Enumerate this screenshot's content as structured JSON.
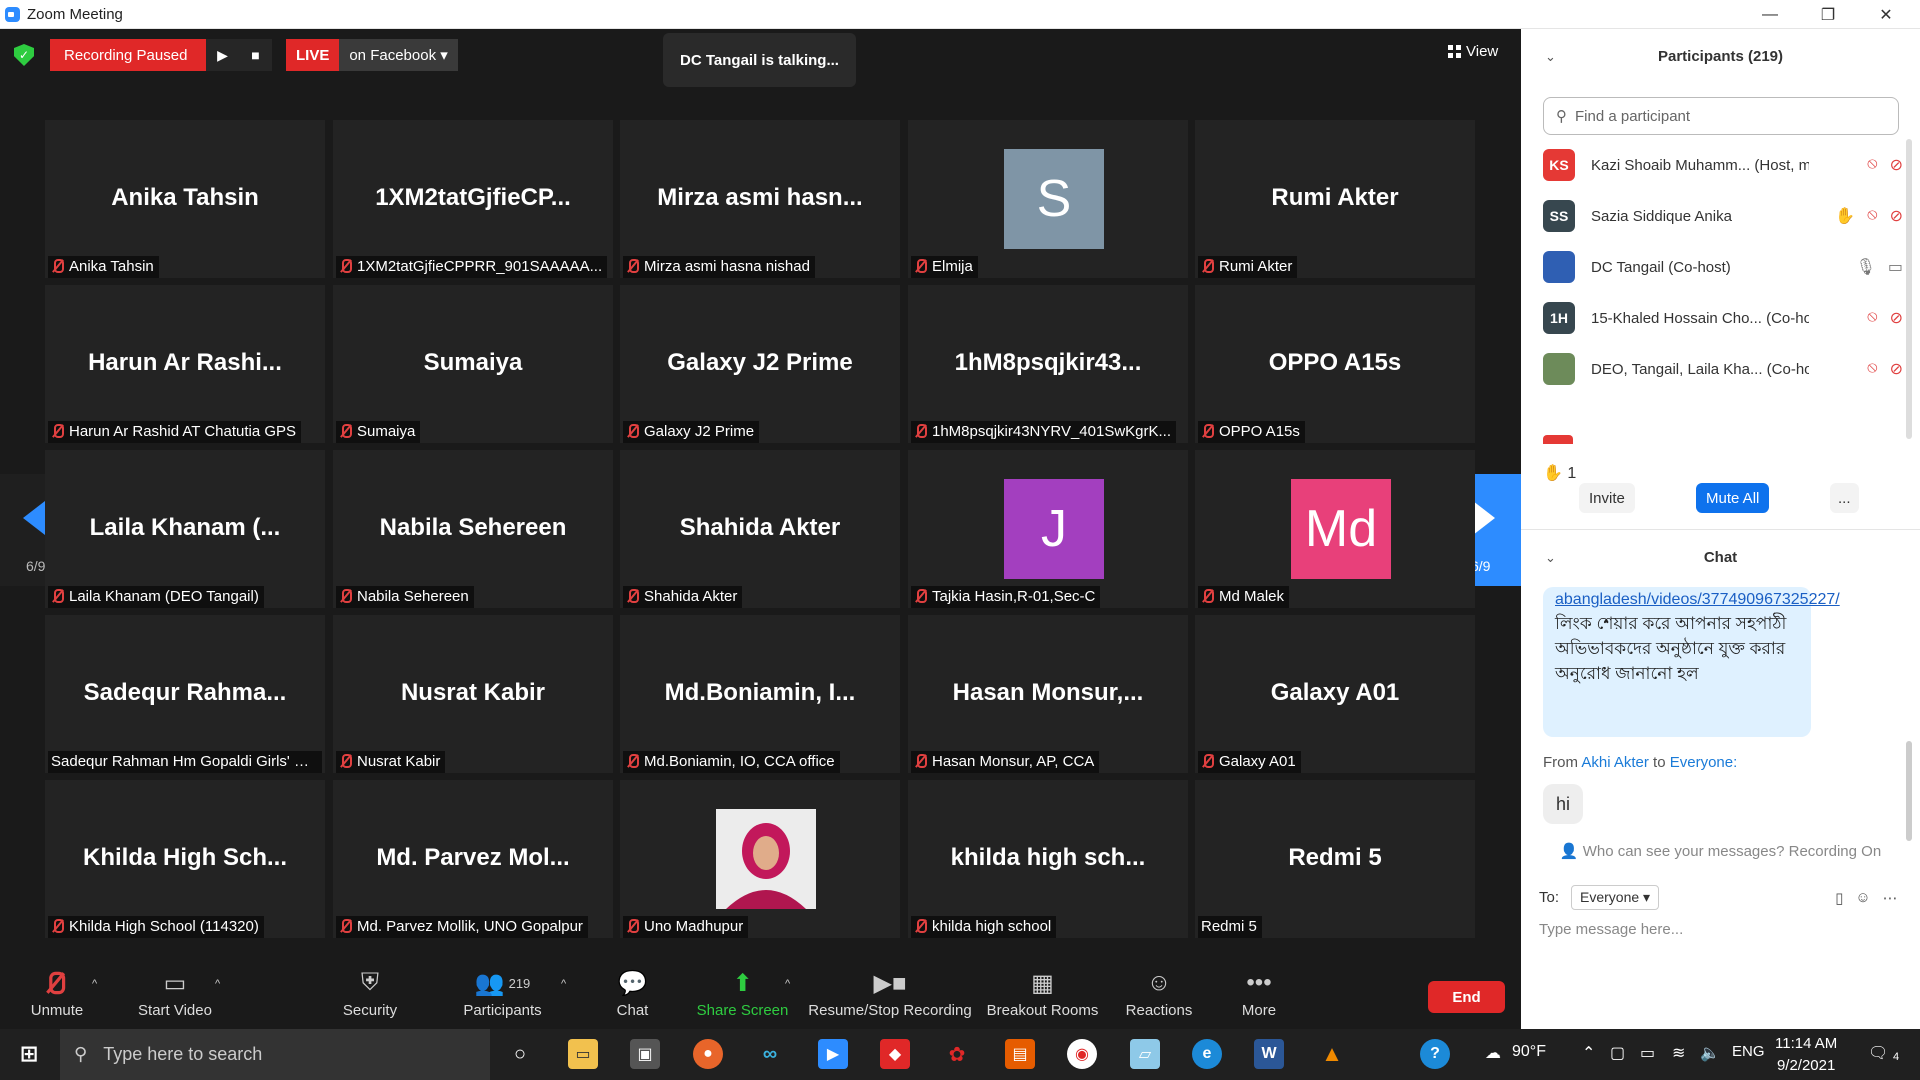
{
  "window": {
    "title": "Zoom Meeting",
    "minimize": "—",
    "restore": "❐",
    "close": "✕"
  },
  "top": {
    "recording_label": "Recording Paused",
    "play": "▶",
    "stop": "■",
    "live": "LIVE",
    "live_target": "on Facebook ▾",
    "talking": "DC Tangail is talking...",
    "view": "View"
  },
  "page_indicator": "6/9",
  "tiles": [
    {
      "big": "Anika Tahsin",
      "label": "Anika Tahsin",
      "muted": true
    },
    {
      "big": "1XM2tatGjfieCP...",
      "label": "1XM2tatGjfieCPPRR_901SAAAAA...",
      "muted": true
    },
    {
      "big": "Mirza  asmi  hasn...",
      "label": "Mirza asmi hasna nishad",
      "muted": true
    },
    {
      "avatar": "S",
      "avatar_color": "#7f95a6",
      "label": "Elmija",
      "muted": true
    },
    {
      "big": "Rumi Akter",
      "label": "Rumi Akter",
      "muted": true
    },
    {
      "big": "Harun  Ar  Rashi...",
      "label": "Harun Ar Rashid AT Chatutia GPS",
      "muted": true
    },
    {
      "big": "Sumaiya",
      "label": "Sumaiya",
      "muted": true
    },
    {
      "big": "Galaxy J2 Prime",
      "label": "Galaxy J2 Prime",
      "muted": true
    },
    {
      "big": "1hM8psqjkir43...",
      "label": "1hM8psqjkir43NYRV_401SwKgrK...",
      "muted": true
    },
    {
      "big": "OPPO A15s",
      "label": "OPPO A15s",
      "muted": true
    },
    {
      "big": "Laila  Khanam  (...",
      "label": "Laila Khanam (DEO Tangail)",
      "muted": true
    },
    {
      "big": "Nabila Sehereen",
      "label": "Nabila Sehereen",
      "muted": true
    },
    {
      "big": "Shahida Akter",
      "label": "Shahida Akter",
      "muted": true
    },
    {
      "avatar": "J",
      "avatar_color": "#a33fbf",
      "label": "Tajkia Hasin,R-01,Sec-C",
      "muted": true
    },
    {
      "avatar": "Md",
      "avatar_color": "#e8407a",
      "label": "Md Malek",
      "muted": true
    },
    {
      "big": "Sadequr  Rahma...",
      "label": "Sadequr Rahman Hm Gopaldi Girls' H...",
      "muted": false
    },
    {
      "big": "Nusrat Kabir",
      "label": "Nusrat Kabir",
      "muted": true
    },
    {
      "big": "Md.Boniamin,  I...",
      "label": "Md.Boniamin, IO, CCA office",
      "muted": true
    },
    {
      "big": "Hasan  Monsur,...",
      "label": "Hasan Monsur, AP, CCA",
      "muted": true
    },
    {
      "big": "Galaxy A01",
      "label": "Galaxy A01",
      "muted": true
    },
    {
      "big": "Khilda  High  Sch...",
      "label": "Khilda High School (114320)",
      "muted": true
    },
    {
      "big": "Md.  Parvez  Mol...",
      "label": "Md. Parvez Mollik, UNO Gopalpur",
      "muted": true
    },
    {
      "photo": true,
      "label": "Uno Madhupur",
      "muted": true
    },
    {
      "big": "khilda  high  sch...",
      "label": "khilda high school",
      "muted": true
    },
    {
      "big": "Redmi 5",
      "label": "Redmi 5",
      "muted": false
    }
  ],
  "toolbar": {
    "unmute": "Unmute",
    "start_video": "Start Video",
    "security": "Security",
    "participants": "Participants",
    "participants_count": "219",
    "chat": "Chat",
    "share": "Share Screen",
    "record": "Resume/Stop Recording",
    "breakout": "Breakout Rooms",
    "reactions": "Reactions",
    "more": "More",
    "end": "End"
  },
  "panel": {
    "participants_title": "Participants (219)",
    "find_placeholder": "Find a participant",
    "participants": [
      {
        "initials": "KS",
        "color": "#e53935",
        "name": "Kazi Shoaib Muhamm...",
        "role": "(Host, me)"
      },
      {
        "initials": "SS",
        "color": "#37474f",
        "name": "Sazia Siddique  Anika",
        "role": ""
      },
      {
        "initials": "",
        "color": "#2f5fb3",
        "name": "DC Tangail",
        "role": "(Co-host)"
      },
      {
        "initials": "1H",
        "color": "#37474f",
        "name": "15-Khaled Hossain Cho...",
        "role": "(Co-host)"
      },
      {
        "initials": "",
        "color": "#6d8b5a",
        "name": "DEO, Tangail, Laila Kha...",
        "role": "(Co-host)"
      }
    ],
    "raised_hands": "1",
    "invite": "Invite",
    "mute_all": "Mute All",
    "more": "...",
    "chat_title": "Chat",
    "chat_link": "abangladesh/videos/377490967325227/",
    "chat_text": "লিংক শেয়ার করে আপনার সহপাঠী অভিভাবকদের অনুষ্ঠানে যুক্ত করার অনুরোধ জানানো হল",
    "from_prefix": "From",
    "from_name": "Akhi Akter",
    "to_word": "to",
    "to_name": "Everyone:",
    "msg_hi": "hi",
    "privacy": "Who can see your messages? Recording On",
    "to_label": "To:",
    "to_value": "Everyone ▾",
    "message_placeholder": "Type message here..."
  },
  "taskbar": {
    "search": "Type here to search",
    "weather": "90°F",
    "lang": "ENG",
    "time": "11:14 AM",
    "date": "9/2/2021",
    "notif": "4"
  }
}
